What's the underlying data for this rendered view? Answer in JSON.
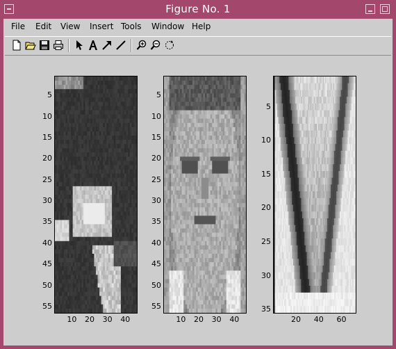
{
  "window": {
    "title": "Figure No. 1"
  },
  "menu": [
    "File",
    "Edit",
    "View",
    "Insert",
    "Tools",
    "Window",
    "Help"
  ],
  "toolbar": {
    "buttons": [
      "new-file-icon",
      "open-folder-icon",
      "save-icon",
      "print-icon",
      "select-arrow-icon",
      "text-insert-icon",
      "arrow-insert-icon",
      "line-insert-icon",
      "zoom-in-icon",
      "zoom-out-icon",
      "rotate-icon"
    ]
  },
  "colors": {
    "titlebar": "#a3476d",
    "client": "#cdcdcd"
  },
  "chart_data": [
    {
      "type": "heatmap",
      "colormap": "gray",
      "content": "grayscale image: dark background with a bright rectangular patch",
      "ylim": [
        1,
        56
      ],
      "xlim": [
        1,
        46
      ],
      "yticks": [
        "5",
        "10",
        "15",
        "20",
        "25",
        "30",
        "35",
        "40",
        "45",
        "50",
        "55"
      ],
      "xticks": [
        "10",
        "20",
        "30",
        "40"
      ]
    },
    {
      "type": "heatmap",
      "colormap": "gray",
      "content": "grayscale image of a face",
      "ylim": [
        1,
        56
      ],
      "xlim": [
        1,
        46
      ],
      "yticks": [
        "5",
        "10",
        "15",
        "20",
        "25",
        "30",
        "35",
        "40",
        "45",
        "50",
        "55"
      ],
      "xticks": [
        "10",
        "20",
        "30",
        "40"
      ]
    },
    {
      "type": "heatmap",
      "colormap": "gray",
      "content": "grayscale image: light V-shaped band pattern",
      "ylim": [
        1,
        35
      ],
      "xlim": [
        1,
        72
      ],
      "yticks": [
        "5",
        "10",
        "15",
        "20",
        "25",
        "30",
        "35"
      ],
      "xticks": [
        "20",
        "40",
        "60"
      ]
    }
  ]
}
